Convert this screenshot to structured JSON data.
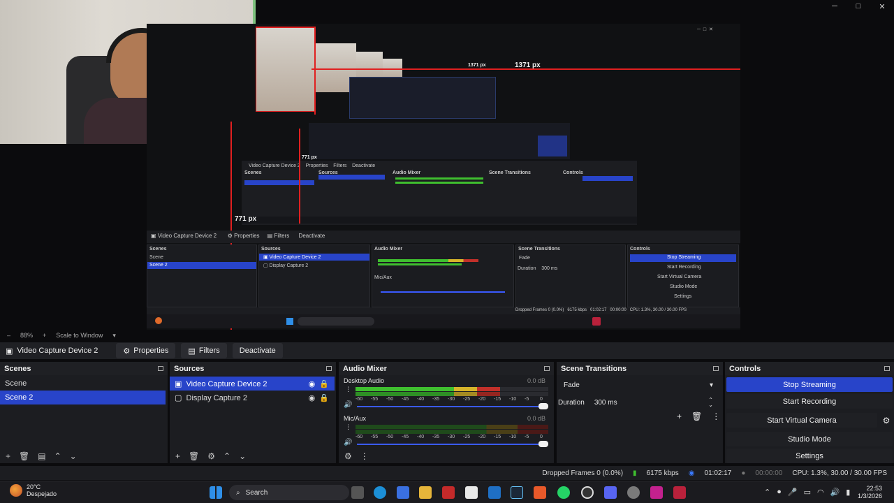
{
  "window": {
    "controls": [
      "─",
      "□",
      "✕"
    ]
  },
  "preview": {
    "measure_top": "1371 px",
    "measure_top_small": "1371 px",
    "measure_left": "771 px",
    "measure_left_small": "771 px"
  },
  "zoom": {
    "percent": "88%",
    "mode": "Scale to Window"
  },
  "source_toolbar": {
    "source_name": "Video Capture Device 2",
    "properties": "Properties",
    "filters": "Filters",
    "deactivate": "Deactivate"
  },
  "scenes": {
    "title": "Scenes",
    "items": [
      "Scene",
      "Scene 2"
    ],
    "selected": 1
  },
  "sources": {
    "title": "Sources",
    "items": [
      "Video Capture Device 2",
      "Display Capture 2"
    ],
    "selected": 0
  },
  "mixer": {
    "title": "Audio Mixer",
    "channels": [
      {
        "name": "Desktop Audio",
        "db": "0.0 dB",
        "level": 0.75
      },
      {
        "name": "Mic/Aux",
        "db": "0.0 dB",
        "level": 0.0
      }
    ],
    "scale": [
      "-60",
      "-55",
      "-50",
      "-45",
      "-40",
      "-35",
      "-30",
      "-25",
      "-20",
      "-15",
      "-10",
      "-5",
      "0"
    ]
  },
  "transitions": {
    "title": "Scene Transitions",
    "selected": "Fade",
    "duration_label": "Duration",
    "duration_value": "300 ms"
  },
  "controls": {
    "title": "Controls",
    "buttons": [
      "Stop Streaming",
      "Start Recording",
      "Start Virtual Camera",
      "Studio Mode",
      "Settings"
    ]
  },
  "status": {
    "dropped": "Dropped Frames 0 (0.0%)",
    "bitrate": "6175 kbps",
    "stream_time": "01:02:17",
    "rec_time": "00:00:00",
    "cpu": "CPU: 1.3%, 30.00 / 30.00 FPS"
  },
  "taskbar": {
    "weather_temp": "20°C",
    "weather_desc": "Despejado",
    "search": "Search",
    "time": "22:53",
    "date": "1/3/2026"
  },
  "colors": {
    "accent": "#2844c9",
    "meter_green": "#3fbf2f",
    "meter_yellow": "#d6b42a",
    "meter_red": "#c2302a",
    "red_guide": "#e02020"
  }
}
